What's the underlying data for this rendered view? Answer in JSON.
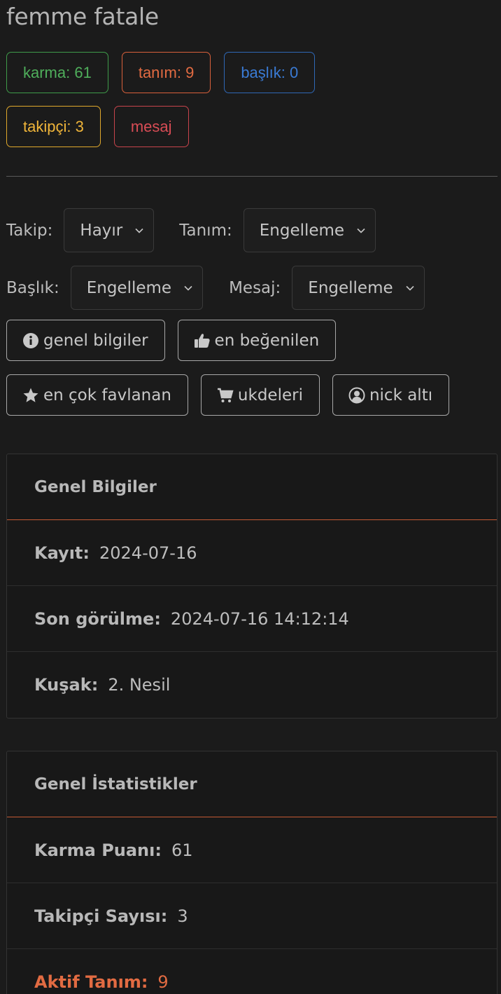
{
  "profile": {
    "name": "femme fatale"
  },
  "badges": {
    "karma": "karma: 61",
    "tanim": "tanım: 9",
    "baslik": "başlık: 0",
    "takipci": "takipçi: 3",
    "mesaj": "mesaj"
  },
  "controls": {
    "takip": {
      "label": "Takip:",
      "value": "Hayır"
    },
    "tanim": {
      "label": "Tanım:",
      "value": "Engelleme"
    },
    "baslik": {
      "label": "Başlık:",
      "value": "Engelleme"
    },
    "mesaj": {
      "label": "Mesaj:",
      "value": "Engelleme"
    }
  },
  "buttons": {
    "genel": "genel bilgiler",
    "begenilen": "en beğenilen",
    "favlanan": "en çok favlanan",
    "ukdeleri": "ukdeleri",
    "nickalti": "nick altı"
  },
  "icons": {
    "genel": "info-circle-icon",
    "begenilen": "thumbs-up-icon",
    "favlanan": "star-icon",
    "ukdeleri": "shopping-cart-icon",
    "nickalti": "user-circle-icon",
    "select": "chevron-down-icon"
  },
  "general_info": {
    "header": "Genel Bilgiler",
    "rows": [
      {
        "key": "Kayıt:",
        "value": "2024-07-16"
      },
      {
        "key": "Son görülme:",
        "value": "2024-07-16 14:12:14"
      },
      {
        "key": "Kuşak:",
        "value": "2. Nesil"
      }
    ]
  },
  "general_stats": {
    "header": "Genel İstatistikler",
    "rows": [
      {
        "key": "Karma Puanı:",
        "value": "61"
      },
      {
        "key": "Takipçi Sayısı:",
        "value": "3"
      },
      {
        "key": "Aktif Tanım:",
        "value": "9"
      }
    ]
  },
  "colors": {
    "background": "#1b1b1b",
    "green": "#4fae5b",
    "orange": "#e26b42",
    "blue": "#3a7bd5",
    "yellow": "#f0b53a",
    "red": "#d84c55"
  }
}
